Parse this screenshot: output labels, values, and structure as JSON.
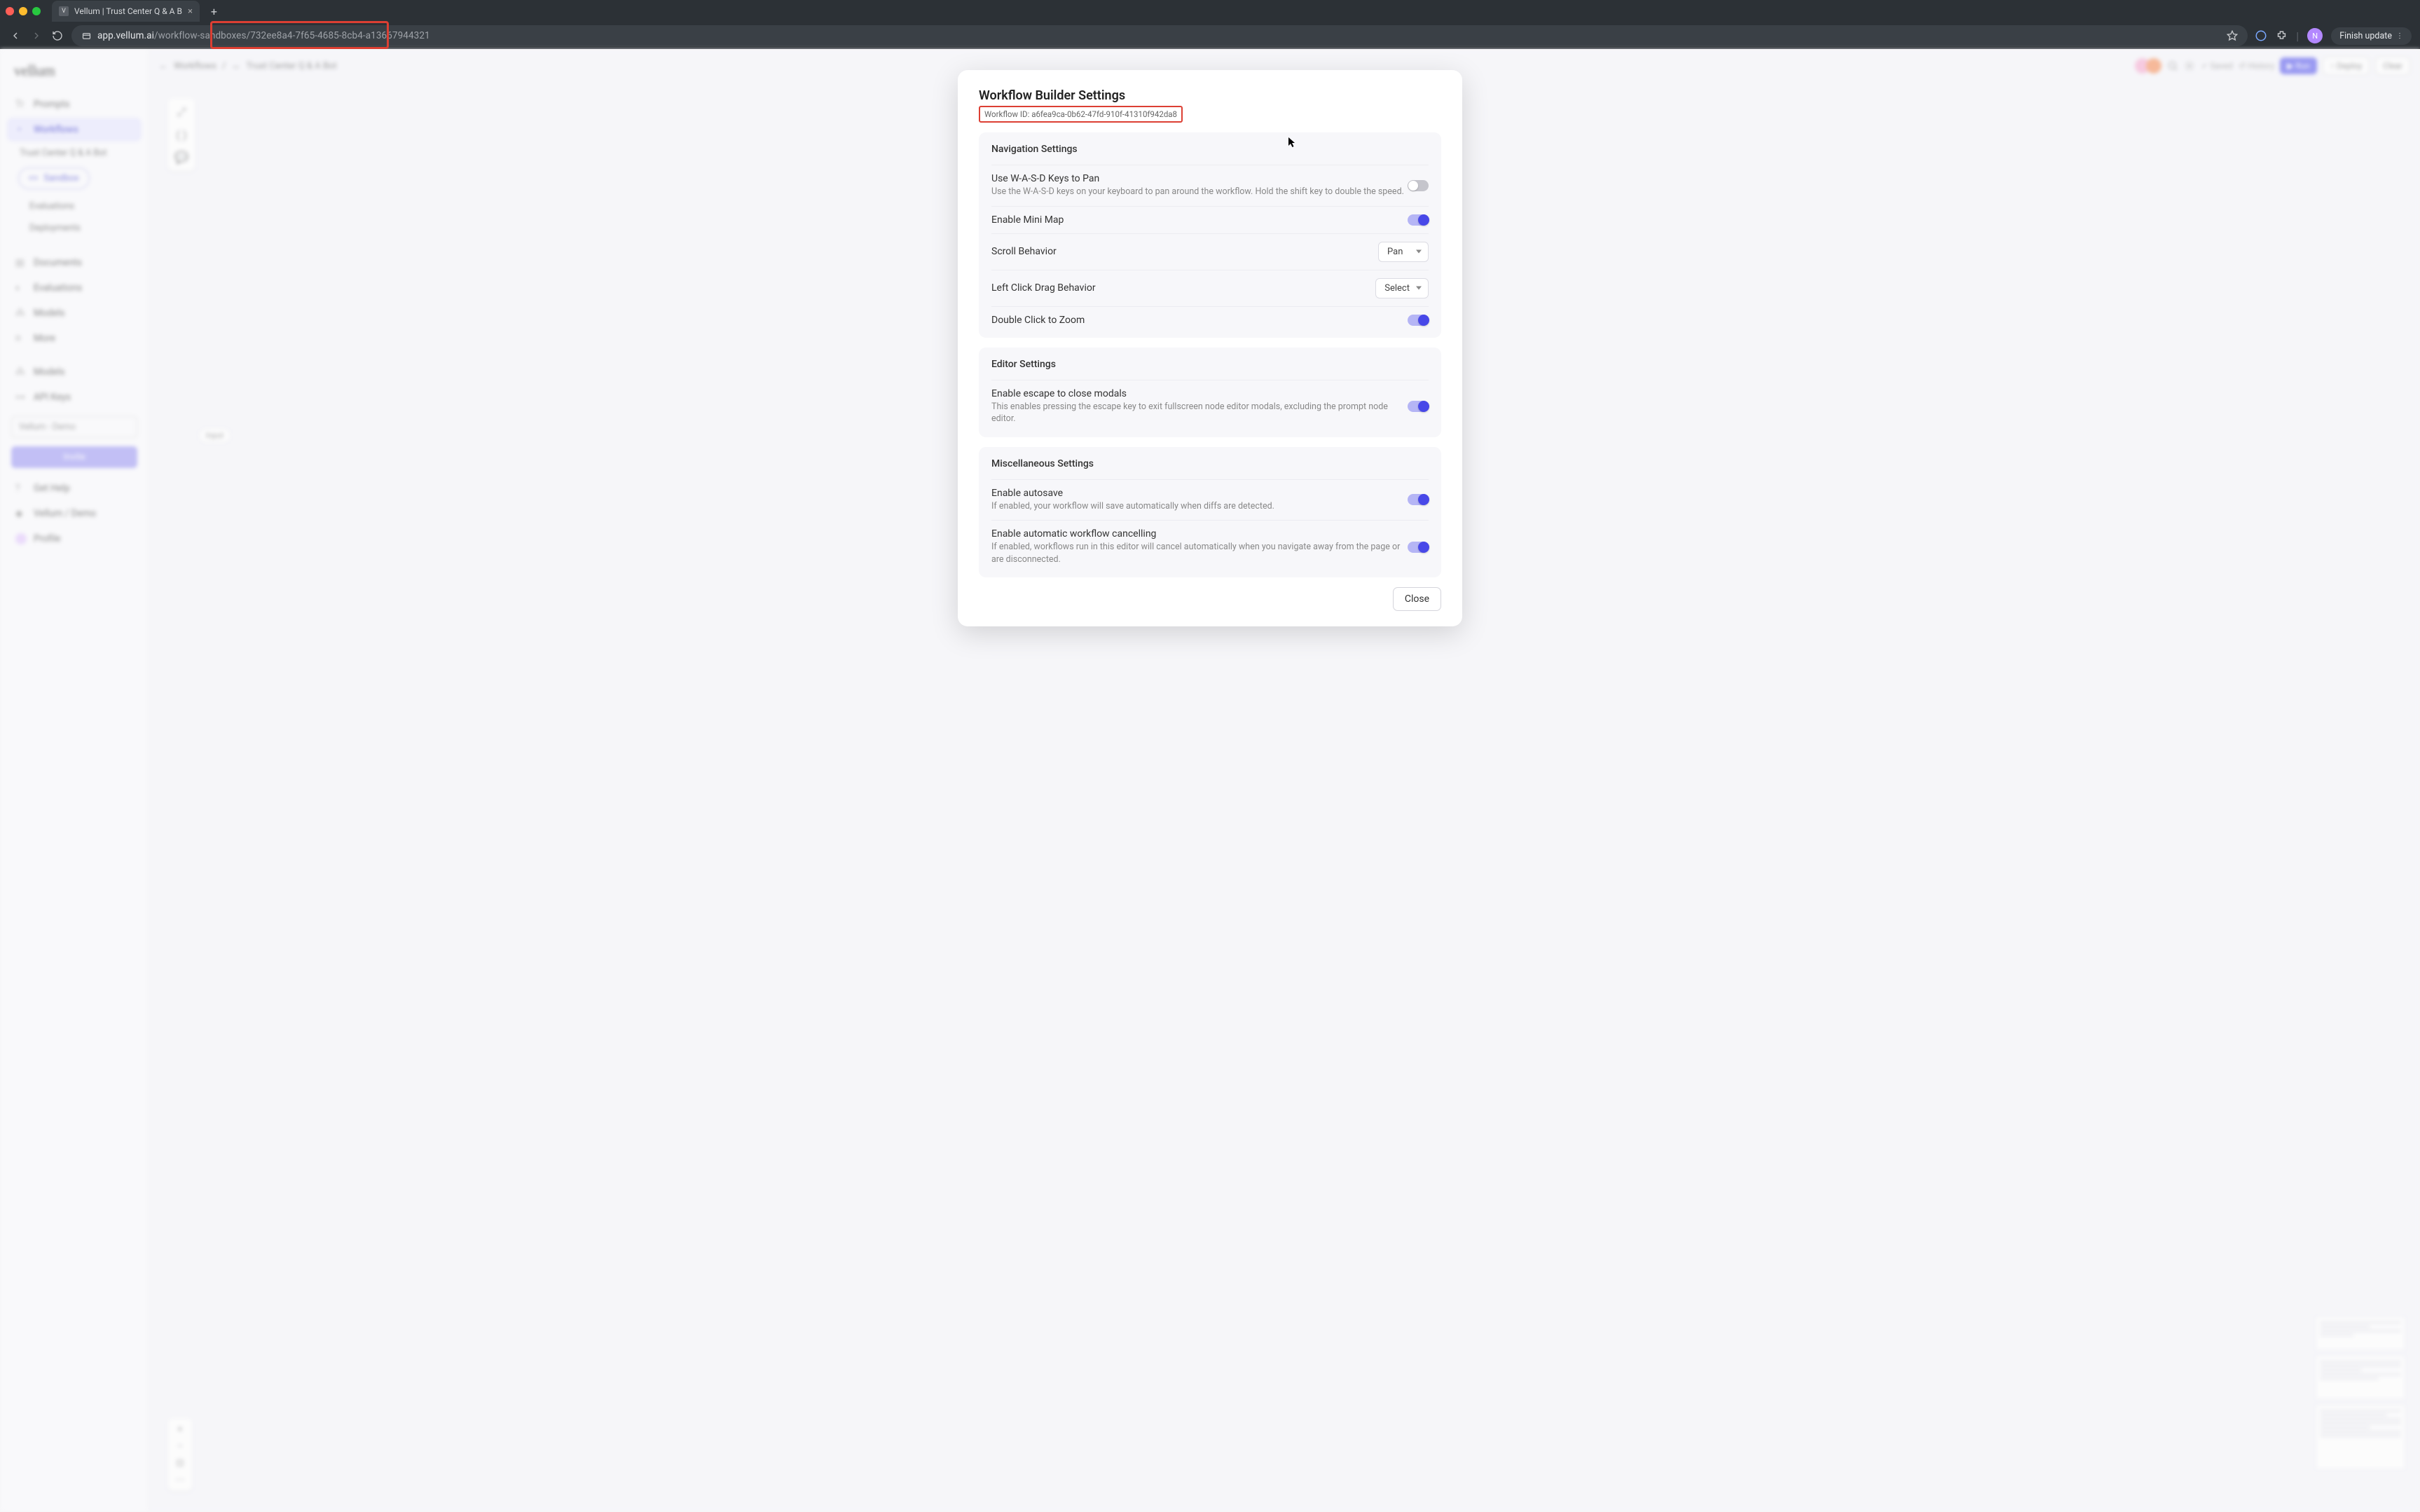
{
  "browser": {
    "tab_title": "Vellum | Trust Center Q & A B",
    "tab_favicon_letter": "V",
    "url_host": "app.vellum.ai",
    "url_path_prefix": "/workflow-sandboxes/",
    "url_path_id": "732ee8a4-7f65-4685-8cb4-a13667944321",
    "finish_update": "Finish update",
    "avatar_letter": "N"
  },
  "sidebar": {
    "logo": "vellum",
    "items": [
      {
        "label": "Prompts"
      },
      {
        "label": "Workflows",
        "active": true
      },
      {
        "label": "Documents"
      },
      {
        "label": "Evaluations"
      },
      {
        "label": "Models"
      },
      {
        "label": "More"
      },
      {
        "label": "Models"
      },
      {
        "label": "API Keys"
      }
    ],
    "sub_label": "Trust Center Q & A Bot",
    "pill": "Sandbox",
    "sub_items": [
      "Evaluations",
      "Deployments"
    ],
    "org_input": "Vellum - Demo",
    "invite": "Invite",
    "footer_items": [
      "Get Help",
      "Vellum / Demo",
      "Profile"
    ]
  },
  "topbar": {
    "breadcrumb1": "Workflows",
    "breadcrumb2": "Trust Center Q & A Bot",
    "run": "Run",
    "deploy": "Deploy",
    "clear": "Clear",
    "saved": "Saved",
    "history": "History"
  },
  "modal": {
    "title": "Workflow Builder Settings",
    "workflow_id_label": "Workflow ID: ",
    "workflow_id": "a6fea9ca-0b62-47fd-910f-41310f942da8",
    "nav_section": "Navigation Settings",
    "editor_section": "Editor Settings",
    "misc_section": "Miscellaneous Settings",
    "rows": {
      "wasd_label": "Use W-A-S-D Keys to Pan",
      "wasd_desc": "Use the W-A-S-D keys on your keyboard to pan around the workflow. Hold the shift key to double the speed.",
      "minimap": "Enable Mini Map",
      "scroll": "Scroll Behavior",
      "scroll_val": "Pan",
      "drag": "Left Click Drag Behavior",
      "drag_val": "Select",
      "dbl": "Double Click to Zoom",
      "esc_label": "Enable escape to close modals",
      "esc_desc": "This enables pressing the escape key to exit fullscreen node editor modals, excluding the prompt node editor.",
      "autosave_label": "Enable autosave",
      "autosave_desc": "If enabled, your workflow will save automatically when diffs are detected.",
      "cancel_label": "Enable automatic workflow cancelling",
      "cancel_desc": "If enabled, workflows run in this editor will cancel automatically when you navigate away from the page or are disconnected."
    },
    "close": "Close"
  },
  "canvas": {
    "node": "Input"
  }
}
